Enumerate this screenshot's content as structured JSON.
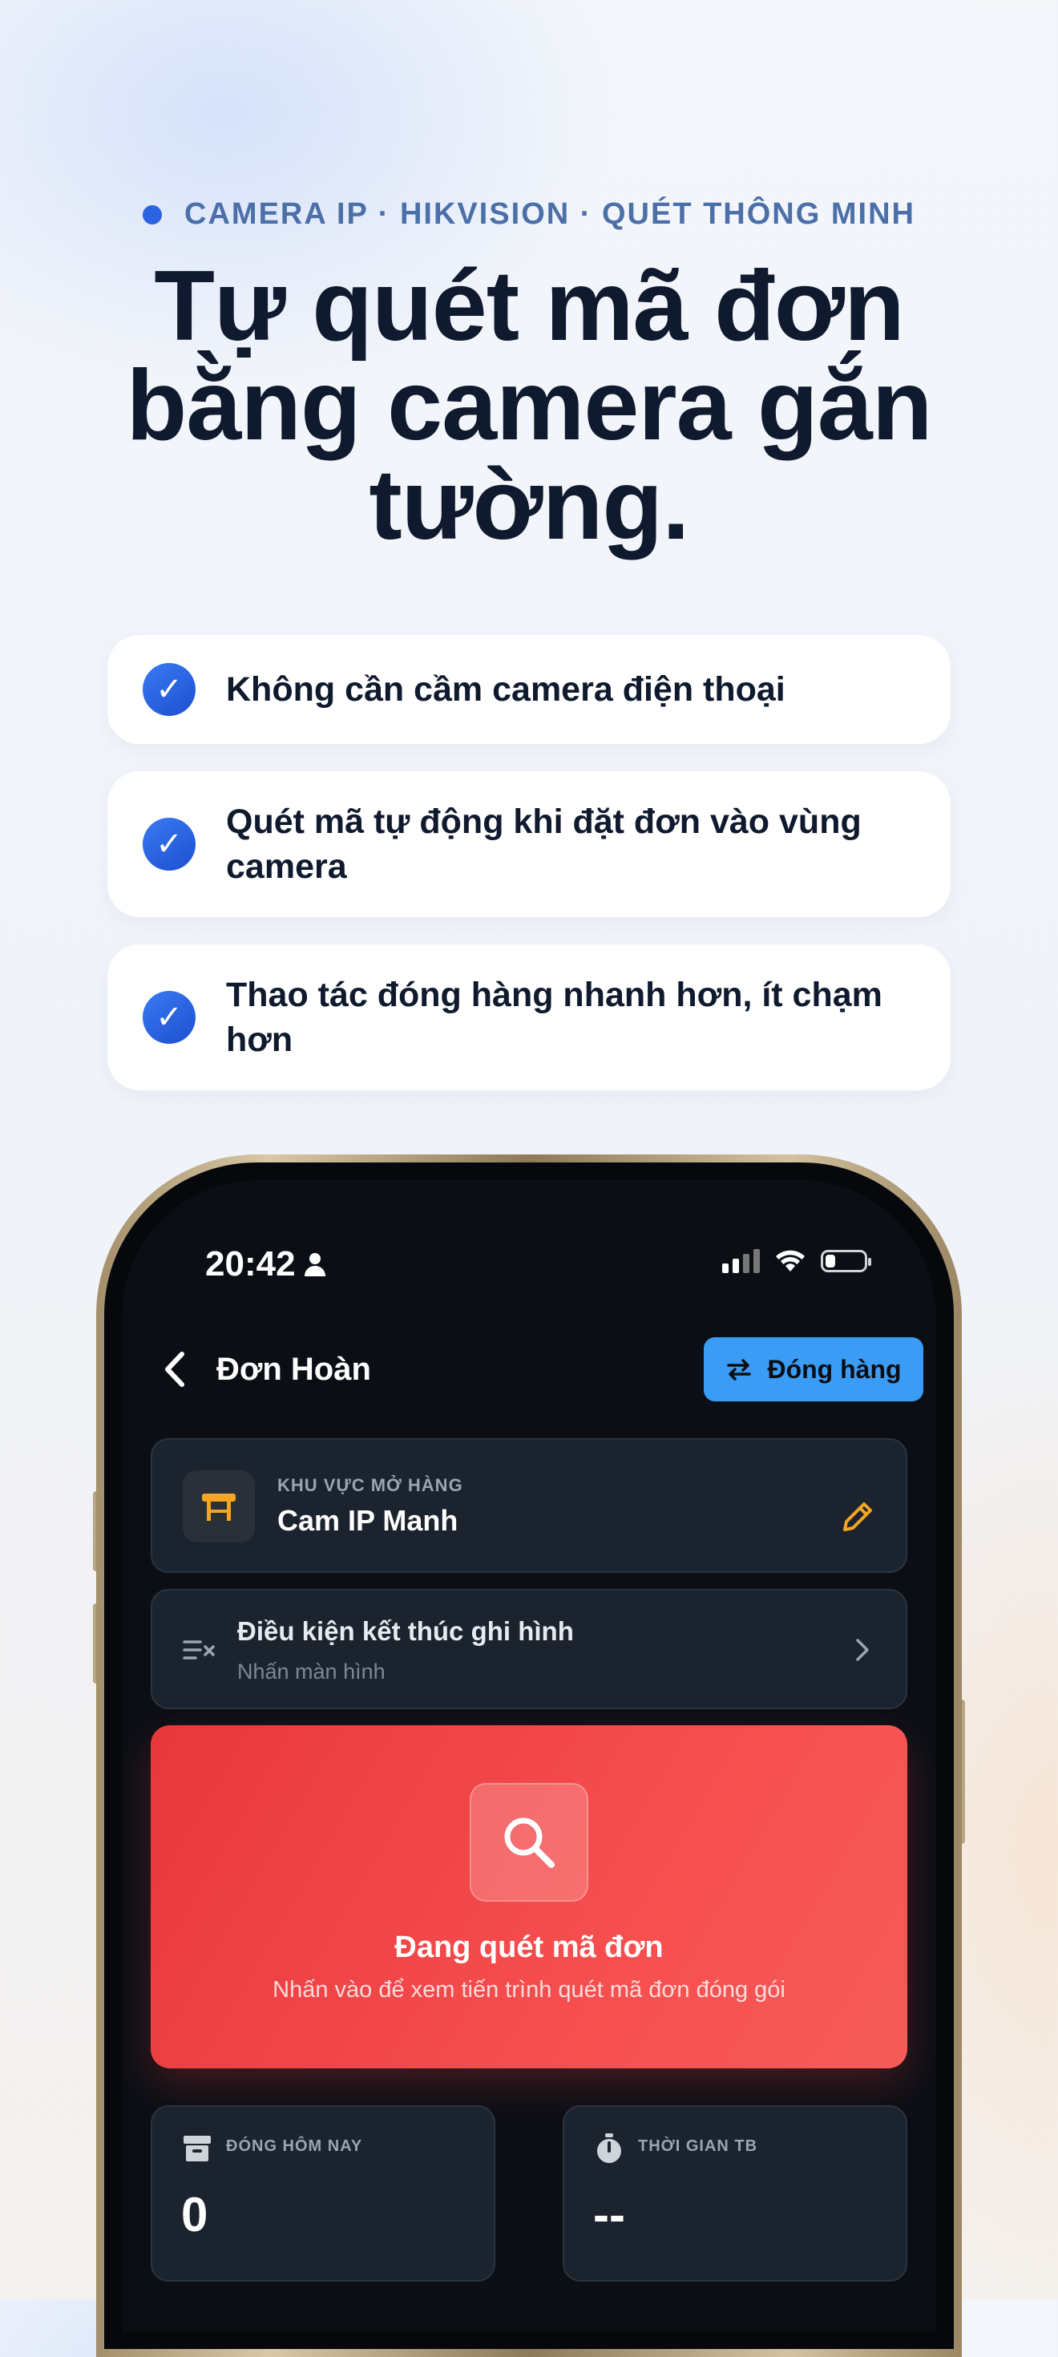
{
  "hero": {
    "eyebrow": "CAMERA IP · HIKVISION · QUÉT THÔNG MINH",
    "headline": "Tự quét mã đơn bằng camera gắn tường."
  },
  "features": [
    {
      "text": "Không cần cầm camera điện thoại"
    },
    {
      "text": "Quét mã tự động khi đặt đơn vào vùng camera"
    },
    {
      "text": "Thao tác đóng hàng nhanh hơn, ít chạm hơn"
    }
  ],
  "phone": {
    "status": {
      "time": "20:42"
    },
    "nav": {
      "title": "Đơn Hoàn",
      "action_label": "Đóng hàng"
    },
    "area": {
      "label": "KHU VỰC MỞ HÀNG",
      "value": "Cam IP Manh"
    },
    "condition": {
      "title": "Điều kiện kết thúc ghi hình",
      "subtitle": "Nhấn màn hình"
    },
    "scan": {
      "title": "Đang quét mã đơn",
      "subtitle": "Nhấn vào để xem tiến trình quét mã đơn đóng gói"
    },
    "stats": [
      {
        "label": "ĐÓNG HÔM NAY",
        "value": "0"
      },
      {
        "label": "THỜI GIAN TB",
        "value": "--"
      }
    ]
  },
  "colors": {
    "accent": "#3b9cf5",
    "scan_red": "#f04444",
    "check_blue": "#2c63e0",
    "edit_orange": "#f5a524"
  }
}
